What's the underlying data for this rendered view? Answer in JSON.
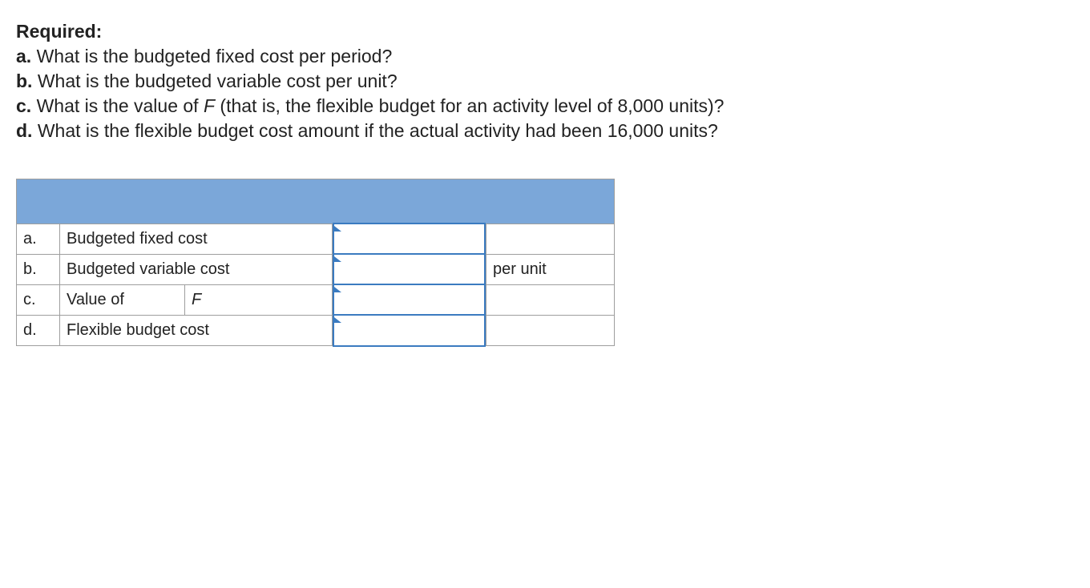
{
  "required_label": "Required:",
  "questions": {
    "a": {
      "letter": "a.",
      "text": "What is the budgeted fixed cost per period?"
    },
    "b": {
      "letter": "b.",
      "text": "What is the budgeted variable cost per unit?"
    },
    "c": {
      "letter": "c.",
      "prefix": "What is the value of ",
      "var": "F",
      "suffix": " (that is, the flexible budget for an activity level of 8,000 units)?"
    },
    "d": {
      "letter": "d.",
      "text": "What is the flexible budget cost amount if the actual activity had been 16,000 units?"
    }
  },
  "table": {
    "rows": {
      "a": {
        "letter": "a.",
        "desc": "Budgeted fixed cost",
        "value": "",
        "unit": ""
      },
      "b": {
        "letter": "b.",
        "desc": "Budgeted variable cost",
        "value": "",
        "unit": "per unit"
      },
      "c": {
        "letter": "c.",
        "desc_left": "Value of",
        "desc_right": "F",
        "value": "",
        "unit": ""
      },
      "d": {
        "letter": "d.",
        "desc": "Flexible budget cost",
        "value": "",
        "unit": ""
      }
    }
  }
}
